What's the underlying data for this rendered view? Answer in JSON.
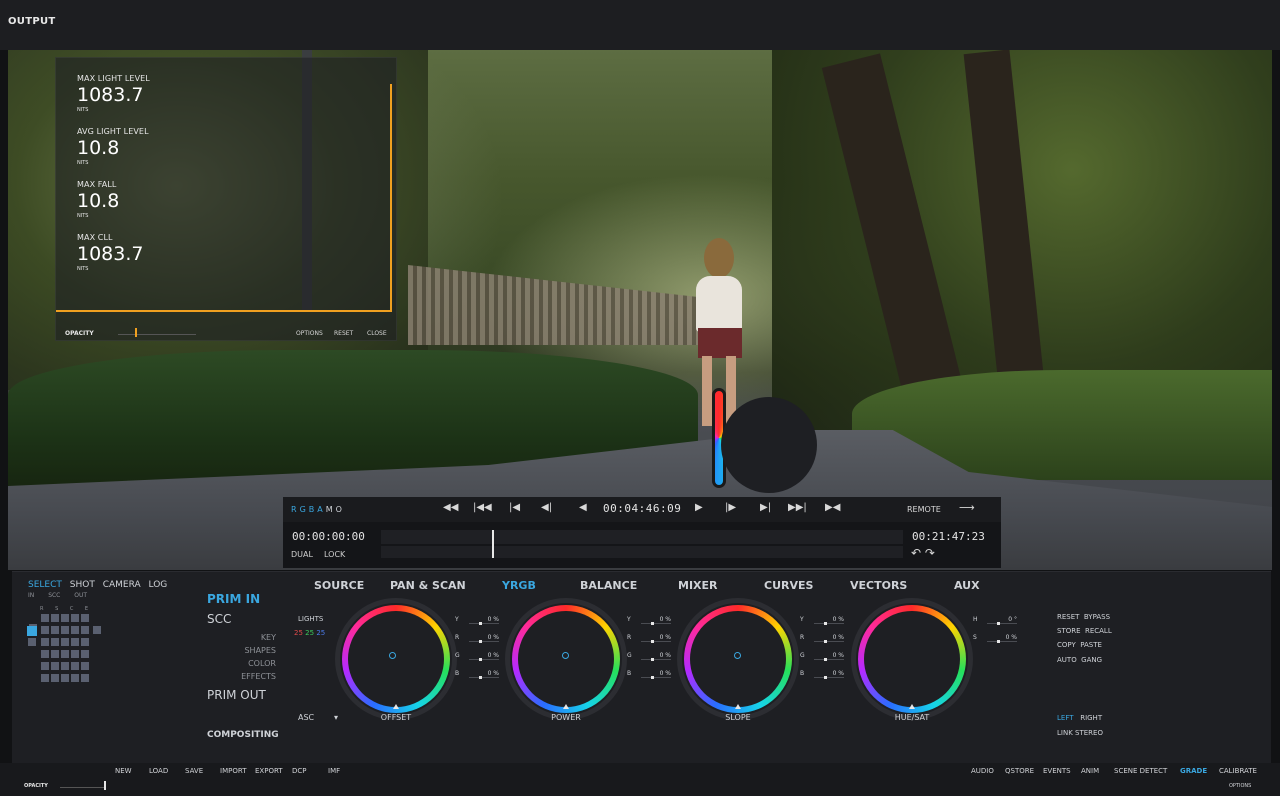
{
  "app": {
    "title": "OUTPUT"
  },
  "hdr_panel": {
    "metrics": [
      {
        "label": "MAX LIGHT LEVEL",
        "value": "1083.7",
        "unit": "NITS"
      },
      {
        "label": "AVG LIGHT LEVEL",
        "value": "10.8",
        "unit": "NITS"
      },
      {
        "label": "MAX FALL",
        "value": "10.8",
        "unit": "NITS"
      },
      {
        "label": "MAX CLL",
        "value": "1083.7",
        "unit": "NITS"
      }
    ],
    "opacity_label": "OPACITY",
    "options": "OPTIONS",
    "reset": "RESET",
    "close": "CLOSE",
    "accent": "#f0a020"
  },
  "transport": {
    "channels": [
      {
        "label": "R",
        "color": "#3aa7e0"
      },
      {
        "label": "G",
        "color": "#3aa7e0"
      },
      {
        "label": "B",
        "color": "#3aa7e0"
      },
      {
        "label": "A",
        "color": "#3aa7e0"
      },
      {
        "label": "M",
        "color": "#cfd2d7"
      },
      {
        "label": "O",
        "color": "#cfd2d7"
      }
    ],
    "buttons": [
      "first-frame",
      "previous-clip",
      "previous-mark",
      "step-back",
      "play-reverse",
      "play-forward",
      "step-forward",
      "next-mark",
      "next-clip",
      "last-frame"
    ],
    "glyphs": [
      "◀◀",
      "|◀◀",
      "|◀",
      "◀|",
      "◀",
      "▶",
      "|▶",
      "▶|",
      "▶▶|",
      "▶◀"
    ],
    "timecode": "00:04:46:09",
    "remote": "REMOTE",
    "remote_arrow": "⟶"
  },
  "timeline": {
    "tc_in": "00:00:00:00",
    "tc_out": "00:21:47:23",
    "dual": "DUAL",
    "lock": "LOCK",
    "undo_redo": "↶ ↷"
  },
  "panel": {
    "mode_tabs": [
      {
        "label": "SELECT",
        "active": true
      },
      {
        "label": "SHOT",
        "active": false
      },
      {
        "label": "CAMERA",
        "active": false
      },
      {
        "label": "LOG",
        "active": false
      }
    ],
    "sub_tabs": [
      "IN",
      "SCC",
      "OUT"
    ],
    "rsce": "R S C E",
    "prim_in": "PRIM IN",
    "scc": "SCC",
    "scc_items": [
      "KEY",
      "SHAPES",
      "COLOR",
      "EFFECTS"
    ],
    "prim_out": "PRIM OUT",
    "compositing": "COMPOSITING",
    "grade_tabs": [
      {
        "label": "SOURCE",
        "active": false
      },
      {
        "label": "PAN & SCAN",
        "active": false
      },
      {
        "label": "YRGB",
        "active": true
      },
      {
        "label": "BALANCE",
        "active": false
      },
      {
        "label": "MIXER",
        "active": false
      },
      {
        "label": "CURVES",
        "active": false
      },
      {
        "label": "VECTORS",
        "active": false
      },
      {
        "label": "AUX",
        "active": false
      }
    ],
    "lights": {
      "label": "LIGHTS",
      "values": [
        {
          "v": "25",
          "color": "#e04a4a"
        },
        {
          "v": "25",
          "color": "#3cc85a"
        },
        {
          "v": "25",
          "color": "#4a7ae8"
        }
      ]
    },
    "asc": "ASC",
    "asc_caret": "▾",
    "wheels": [
      {
        "label": "OFFSET",
        "params": [
          {
            "k": "Y",
            "v": "0 %"
          },
          {
            "k": "R",
            "v": "0 %"
          },
          {
            "k": "G",
            "v": "0 %"
          },
          {
            "k": "B",
            "v": "0 %"
          }
        ]
      },
      {
        "label": "POWER",
        "params": [
          {
            "k": "Y",
            "v": "0 %"
          },
          {
            "k": "R",
            "v": "0 %"
          },
          {
            "k": "G",
            "v": "0 %"
          },
          {
            "k": "B",
            "v": "0 %"
          }
        ]
      },
      {
        "label": "SLOPE",
        "params": [
          {
            "k": "Y",
            "v": "0 %"
          },
          {
            "k": "R",
            "v": "0 %"
          },
          {
            "k": "G",
            "v": "0 %"
          },
          {
            "k": "B",
            "v": "0 %"
          }
        ]
      },
      {
        "label": "HUE/SAT",
        "params": [
          {
            "k": "H",
            "v": "0 °"
          },
          {
            "k": "S",
            "v": "0 %"
          }
        ]
      }
    ],
    "utils": [
      [
        "RESET",
        "BYPASS"
      ],
      [
        "STORE",
        "RECALL"
      ],
      [
        "COPY",
        "PASTE"
      ],
      [
        "AUTO",
        "GANG"
      ]
    ],
    "stereo": {
      "left": "LEFT",
      "right": "RIGHT",
      "link": "LINK STEREO"
    }
  },
  "bottombar": {
    "left_buttons": [
      "NEW",
      "LOAD",
      "SAVE",
      "IMPORT",
      "EXPORT",
      "DCP",
      "IMF"
    ],
    "right_buttons": [
      {
        "label": "AUDIO",
        "active": false
      },
      {
        "label": "QSTORE",
        "active": false
      },
      {
        "label": "EVENTS",
        "active": false
      },
      {
        "label": "ANIM",
        "active": false
      },
      {
        "label": "SCENE DETECT",
        "active": false
      },
      {
        "label": "GRADE",
        "active": true
      },
      {
        "label": "CALIBRATE",
        "active": false
      }
    ],
    "opacity_label": "OPACITY",
    "options": "OPTIONS"
  },
  "colors": {
    "accent_blue": "#3aa7e0",
    "accent_orange": "#f0a020"
  }
}
